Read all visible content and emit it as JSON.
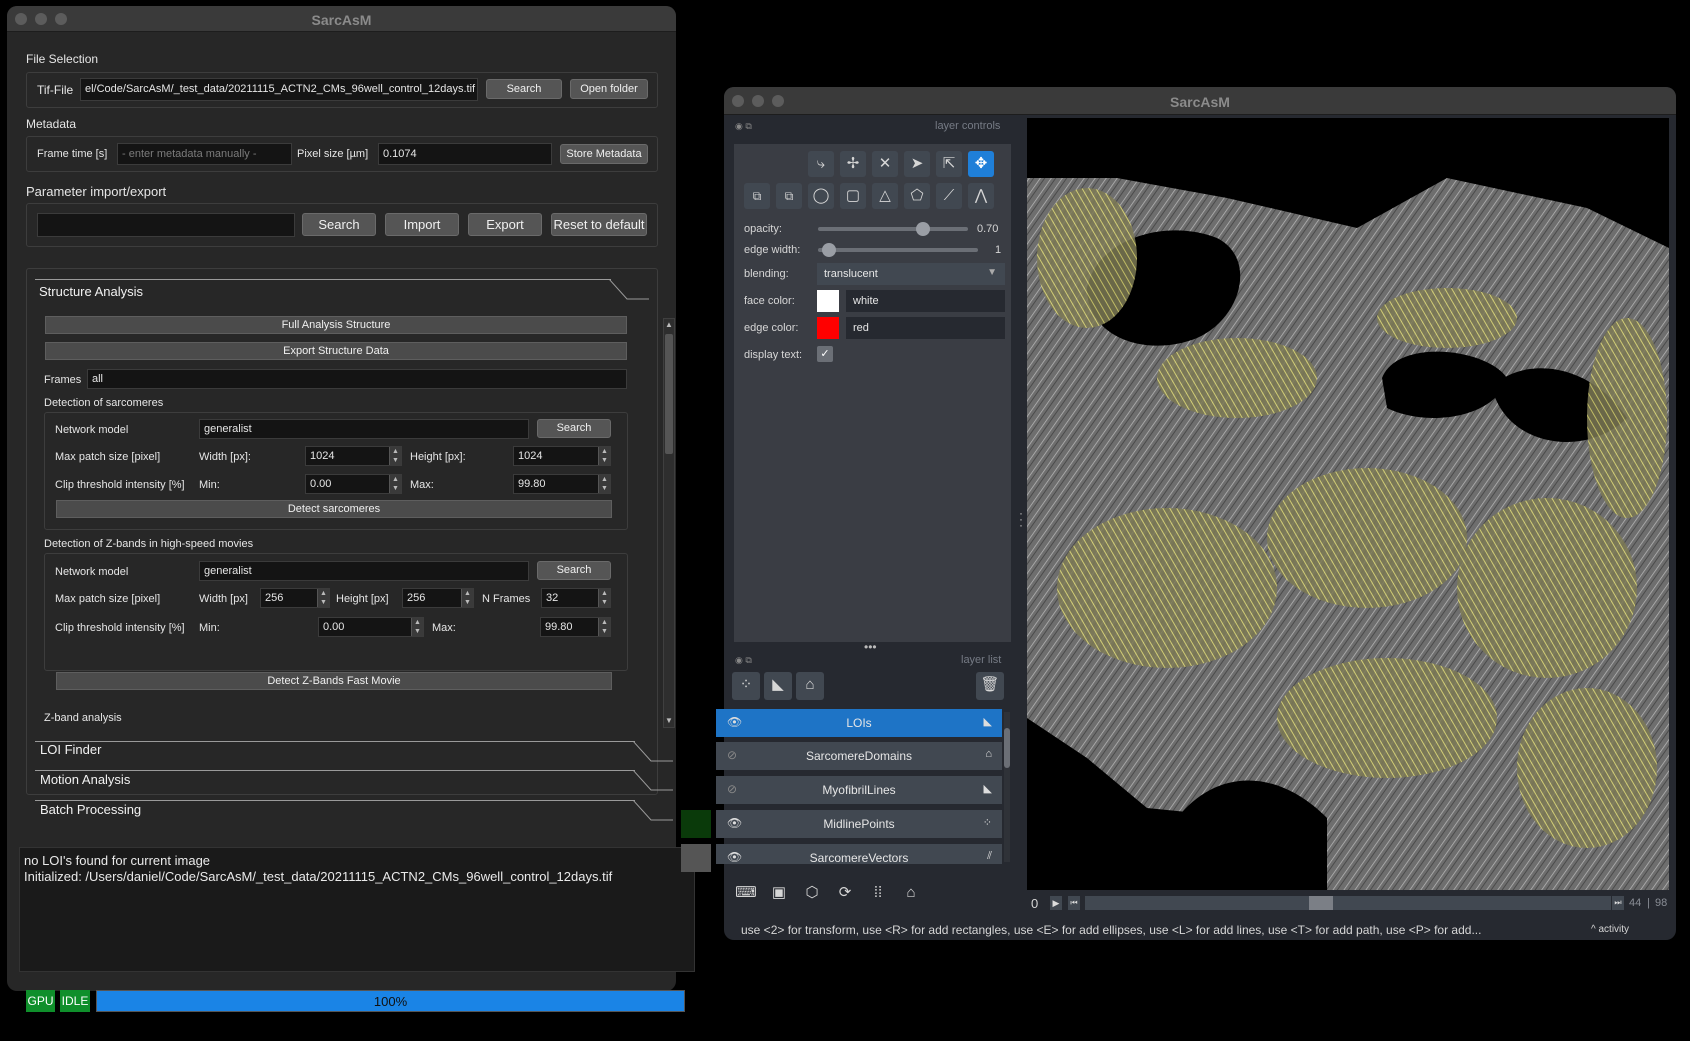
{
  "left_window": {
    "title": "SarcAsM",
    "file_selection": {
      "section": "File Selection",
      "tif_label": "Tif-File",
      "tif_value": "el/Code/SarcAsM/_test_data/20211115_ACTN2_CMs_96well_control_12days.tif",
      "search": "Search",
      "open_folder": "Open folder"
    },
    "metadata": {
      "section": "Metadata",
      "frame_time_label": "Frame time [s]",
      "frame_time_placeholder": "- enter metadata manually -",
      "pixel_size_label": "Pixel size [µm]",
      "pixel_size_value": "0.1074",
      "store": "Store Metadata"
    },
    "params": {
      "section": "Parameter import/export",
      "search": "Search",
      "import": "Import",
      "export": "Export",
      "reset": "Reset to default"
    },
    "structure": {
      "header": "Structure Analysis",
      "full_analysis": "Full Analysis Structure",
      "export_data": "Export Structure Data",
      "frames_label": "Frames",
      "frames_value": "all",
      "det_sarc_title": "Detection of sarcomeres",
      "network_model_label": "Network model",
      "network_model_value": "generalist",
      "search": "Search",
      "max_patch_label": "Max patch size [pixel]",
      "width_label": "Width [px]:",
      "width_value": "1024",
      "height_label": "Height [px]:",
      "height_value": "1024",
      "clip_label": "Clip threshold intensity [%]",
      "min_label": "Min:",
      "min_value": "0.00",
      "max_label": "Max:",
      "max_value": "99.80",
      "detect_sarc": "Detect sarcomeres",
      "det_z_title": "Detection of Z-bands in high-speed movies",
      "z_network_model_value": "generalist",
      "z_width_label": "Width [px]",
      "z_width_value": "256",
      "z_height_label": "Height [px]",
      "z_height_value": "256",
      "z_nframes_label": "N Frames",
      "z_nframes_value": "32",
      "z_min_value": "0.00",
      "z_max_value": "99.80",
      "detect_z": "Detect Z-Bands Fast Movie",
      "zband_analysis": "Z-band analysis"
    },
    "accordion": {
      "loi": "LOI Finder",
      "motion": "Motion Analysis",
      "batch": "Batch Processing"
    },
    "log": [
      "no LOI's found for current image",
      "Initialized: /Users/daniel/Code/SarcAsM/_test_data/20211115_ACTN2_CMs_96well_control_12days.tif"
    ],
    "status": {
      "gpu": "GPU",
      "idle": "IDLE",
      "progress_text": "100%",
      "progress": 1.0
    }
  },
  "right_window": {
    "title": "SarcAsM",
    "layer_controls_title": "layer controls",
    "opacity_label": "opacity:",
    "opacity_value": "0.70",
    "opacity": 0.7,
    "edge_width_label": "edge width:",
    "edge_width_value": "1",
    "blending_label": "blending:",
    "blending_value": "translucent",
    "face_color_label": "face color:",
    "face_color_value": "white",
    "face_color": "#ffffff",
    "edge_color_label": "edge color:",
    "edge_color_value": "red",
    "edge_color": "#ff0000",
    "display_text_label": "display text:",
    "layer_list_title": "layer list",
    "layers": [
      {
        "name": "LOIs",
        "icon": "shapes-icon"
      },
      {
        "name": "SarcomereDomains",
        "icon": "labels-icon"
      },
      {
        "name": "MyofibrilLines",
        "icon": "shapes-icon"
      },
      {
        "name": "MidlinePoints",
        "icon": "points-icon"
      },
      {
        "name": "SarcomereVectors",
        "icon": "vectors-icon"
      }
    ],
    "frame_start": "0",
    "frame_current": "44",
    "frame_total": "98",
    "status_text": "use <2> for transform, use <R> for add rectangles, use <E> for add ellipses, use <L> for add lines, use <T> for add path, use <P> for add...",
    "activity": "activity",
    "accent": "#1f7fd8"
  }
}
